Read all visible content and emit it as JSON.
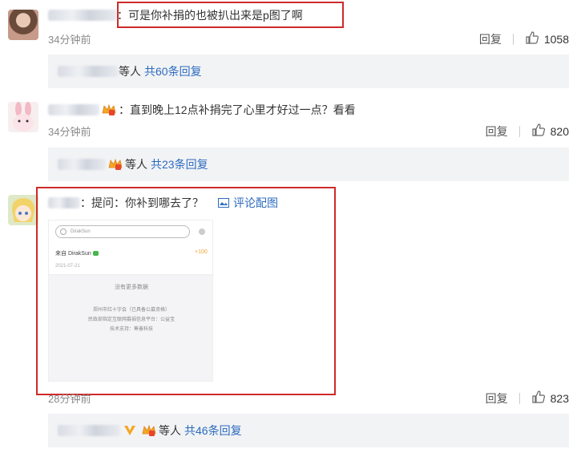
{
  "colors": {
    "accent_link": "#2c6bbf",
    "highlight_frame": "#cf2a2a",
    "reply_bg": "#f2f3f5"
  },
  "comments": [
    {
      "text": "：可是你补捐的也被扒出来是p图了啊",
      "time": "34分钟前",
      "reply_label": "回复",
      "like_icon": "thumbs-up-icon",
      "likes": "1058",
      "replies_prefix": "等人",
      "replies_link": "共60条回复"
    },
    {
      "text": "：直到晚上12点补捐完了心里才好过一点？看看",
      "time": "34分钟前",
      "reply_label": "回复",
      "like_icon": "thumbs-up-icon",
      "likes": "820",
      "replies_prefix": "等人",
      "replies_link": "共23条回复"
    },
    {
      "text": "：提问：你补到哪去了？",
      "image_link": "评论配图",
      "time": "28分钟前",
      "reply_label": "回复",
      "like_icon": "thumbs-up-icon",
      "likes": "823",
      "replies_prefix": "等人",
      "replies_link": "共46条回复"
    }
  ],
  "embedded_image": {
    "search_placeholder": "DirakSun",
    "from_label": "来自 DirakSun",
    "amount": "+100",
    "date": "2021-07-21",
    "no_more": "没有更多数据",
    "org_line1": "郑州市红十字会（已具备公募资格）",
    "org_line2": "民政部指定互联网募捐信息平台：公益宝",
    "org_line3": "技术支持：筹善科技"
  }
}
